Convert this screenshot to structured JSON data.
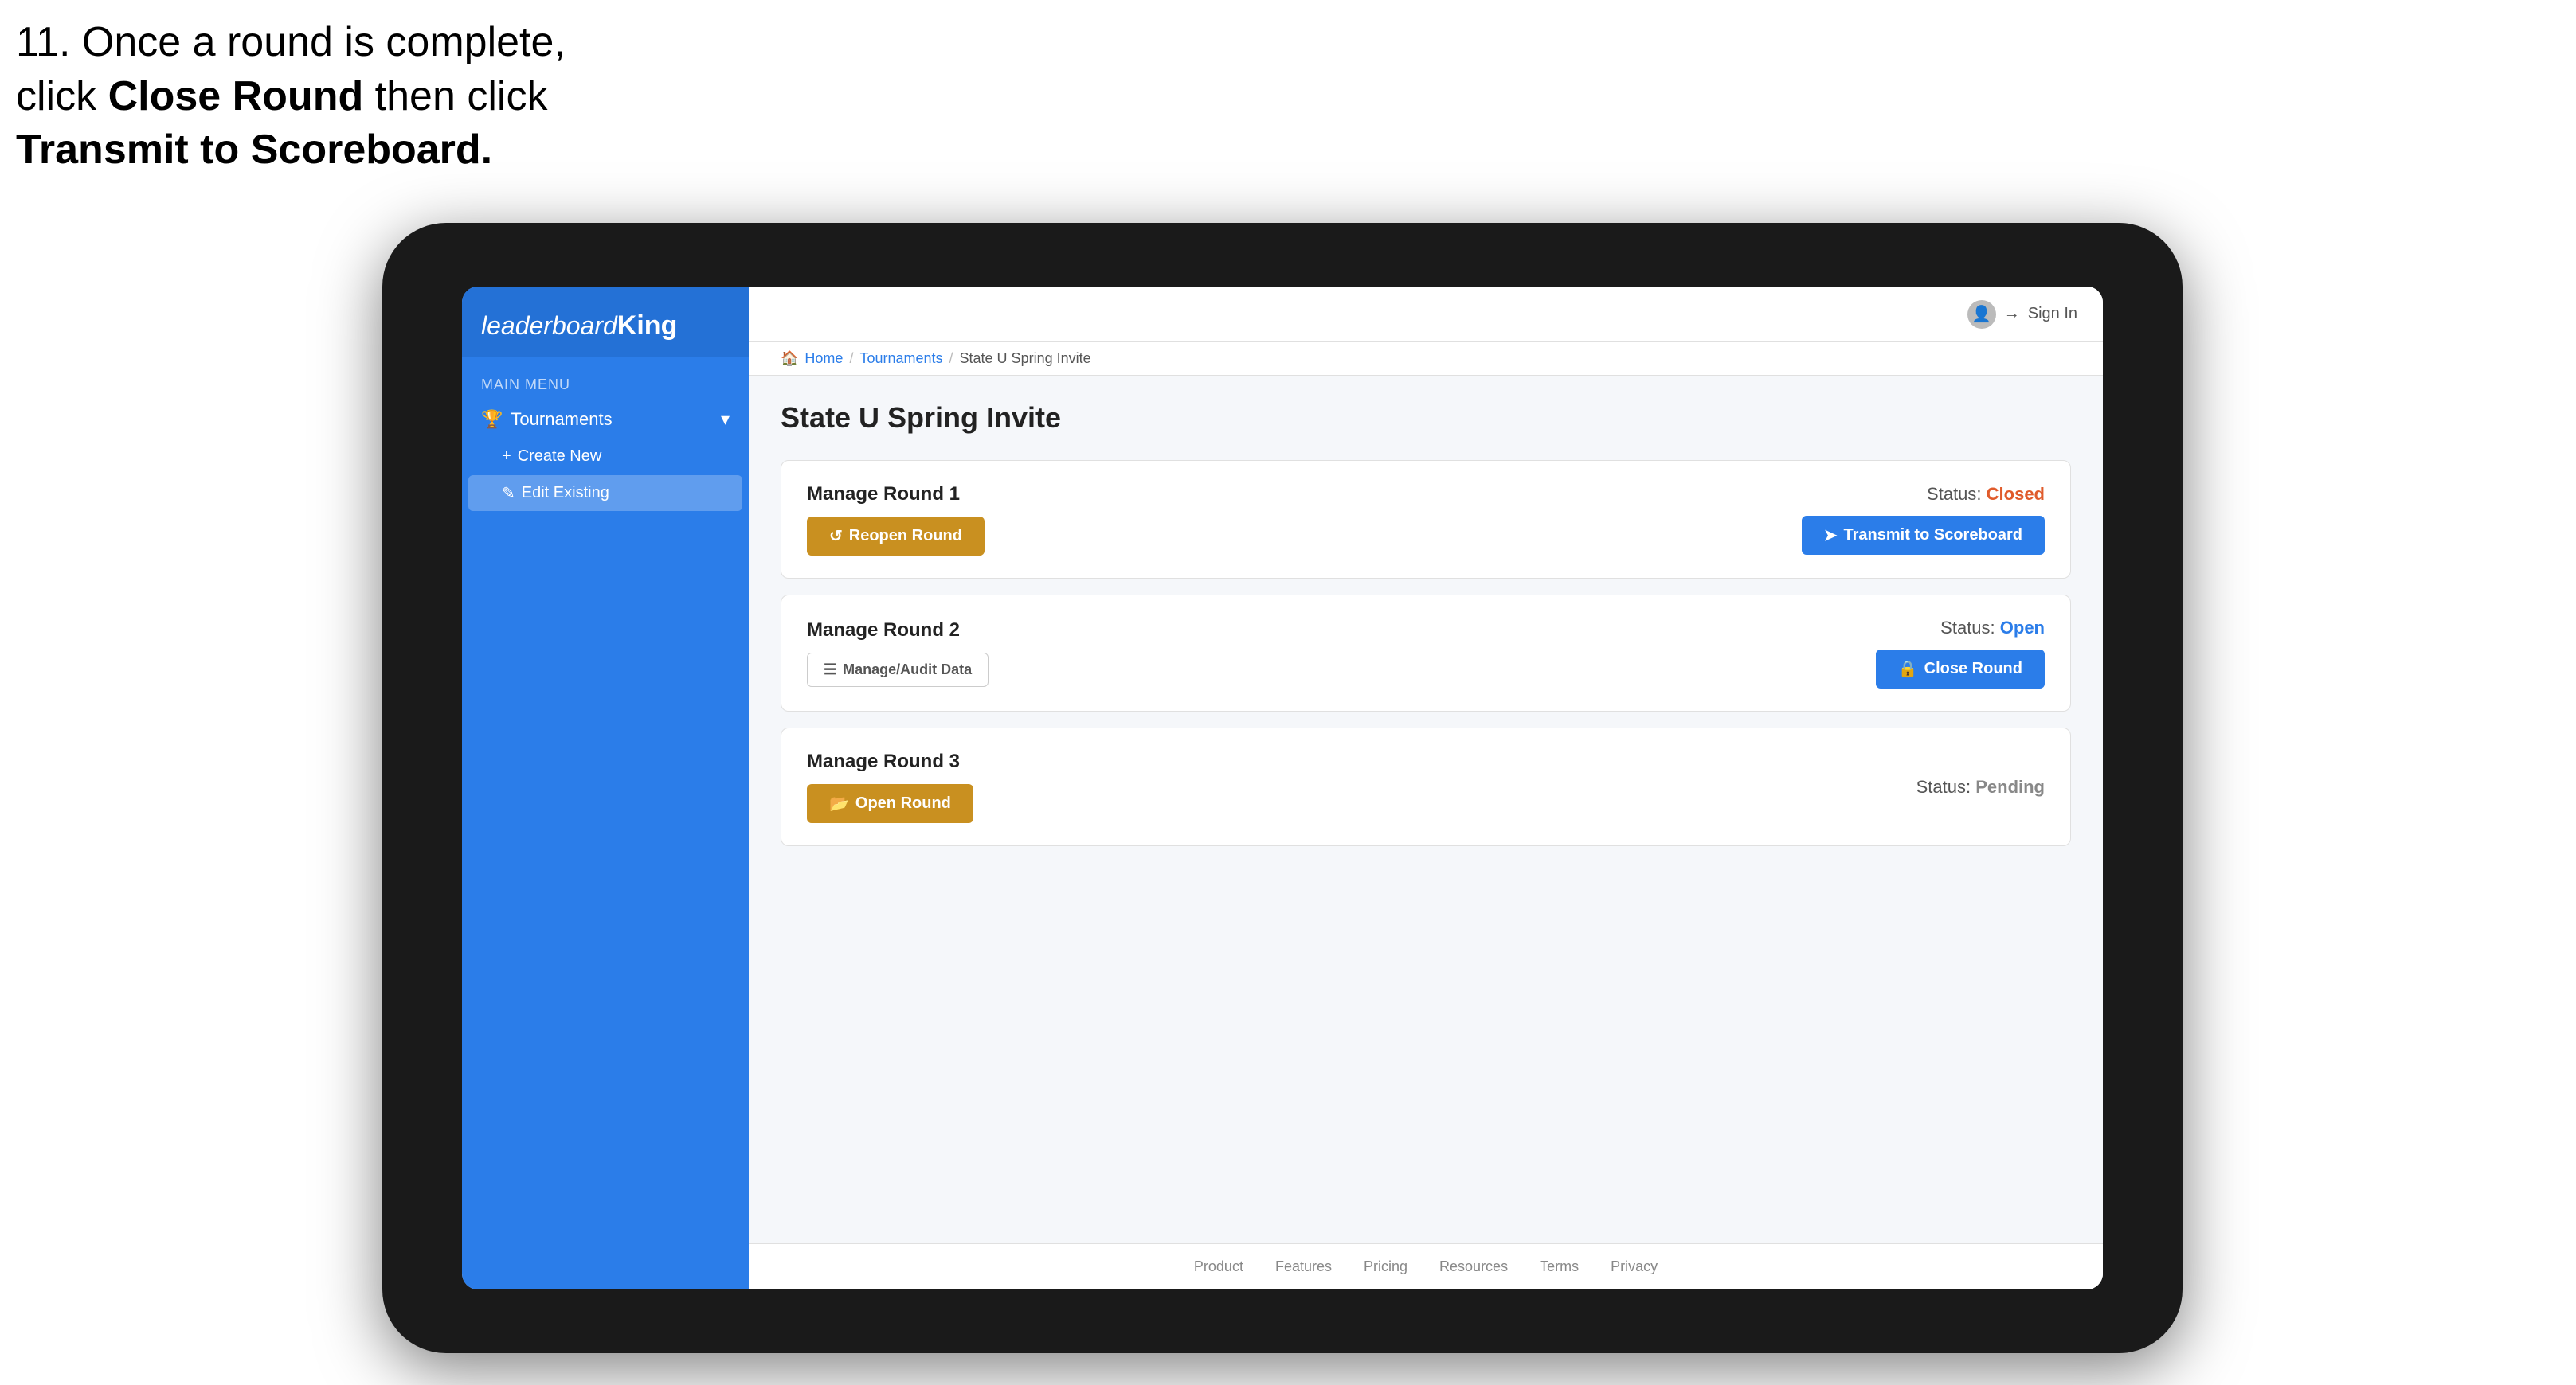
{
  "instruction": {
    "line1": "11. Once a round is complete,",
    "line2": "click ",
    "bold1": "Close Round",
    "line3": " then click",
    "bold2": "Transmit to Scoreboard."
  },
  "app": {
    "logo": "leaderboard",
    "logo_king": "King",
    "top_bar": {
      "sign_in": "Sign In"
    },
    "breadcrumb": {
      "home": "Home",
      "tournaments": "Tournaments",
      "current": "State U Spring Invite"
    },
    "sidebar": {
      "menu_label": "MAIN MENU",
      "nav_items": [
        {
          "label": "Tournaments",
          "expanded": true
        }
      ],
      "sub_items": [
        {
          "label": "Create New",
          "icon": "+"
        },
        {
          "label": "Edit Existing",
          "icon": "✎",
          "active": true
        }
      ]
    },
    "page": {
      "title": "State U Spring Invite",
      "rounds": [
        {
          "title": "Manage Round 1",
          "status_label": "Status:",
          "status_value": "Closed",
          "status_type": "closed",
          "buttons": [
            {
              "label": "Reopen Round",
              "type": "orange",
              "icon": "↺"
            },
            {
              "label": "Transmit to Scoreboard",
              "type": "blue",
              "icon": "➤"
            }
          ]
        },
        {
          "title": "Manage Round 2",
          "status_label": "Status:",
          "status_value": "Open",
          "status_type": "open",
          "buttons": [
            {
              "label": "Manage/Audit Data",
              "type": "small-outline",
              "icon": "☰"
            },
            {
              "label": "Close Round",
              "type": "blue",
              "icon": "🔒"
            }
          ]
        },
        {
          "title": "Manage Round 3",
          "status_label": "Status:",
          "status_value": "Pending",
          "status_type": "pending",
          "buttons": [
            {
              "label": "Open Round",
              "type": "orange",
              "icon": "📂"
            }
          ]
        }
      ]
    },
    "footer": {
      "links": [
        "Product",
        "Features",
        "Pricing",
        "Resources",
        "Terms",
        "Privacy"
      ]
    }
  }
}
